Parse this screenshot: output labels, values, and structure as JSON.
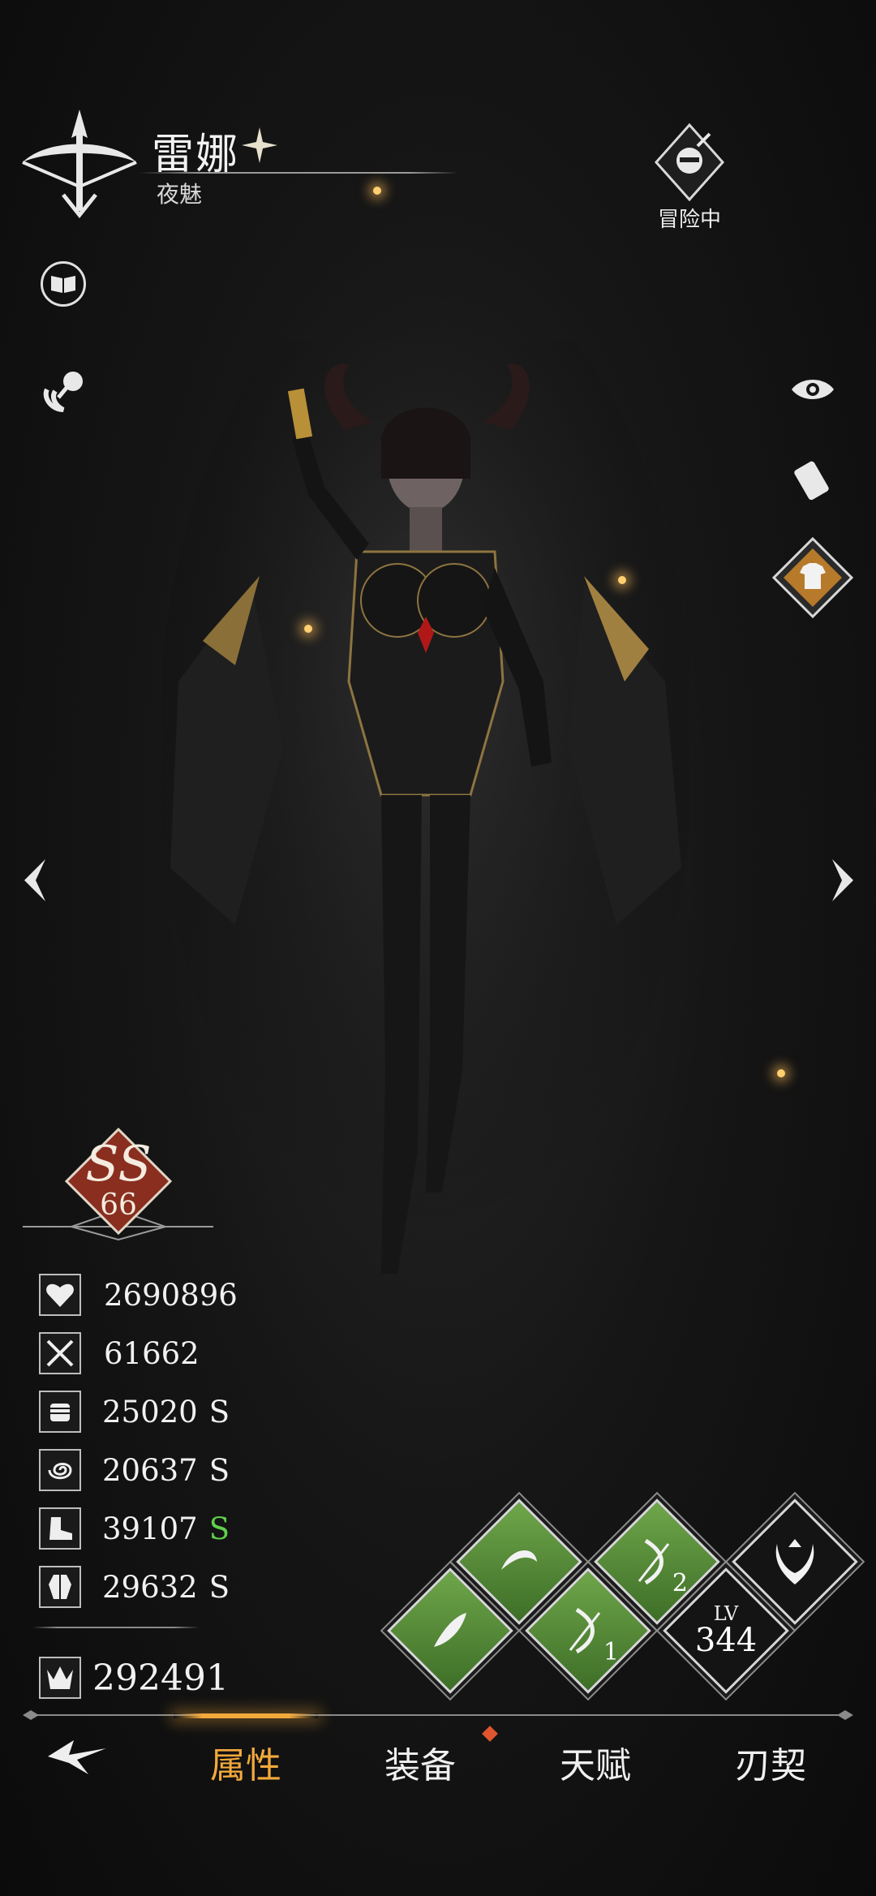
{
  "header": {
    "name": "雷娜",
    "subtitle": "夜魅"
  },
  "status": {
    "label": "冒险中"
  },
  "rank": {
    "grade": "SS",
    "level": "66"
  },
  "stats": [
    {
      "icon": "heart-icon",
      "value": "2690896",
      "grade": ""
    },
    {
      "icon": "crossed-swords-icon",
      "value": "61662",
      "grade": ""
    },
    {
      "icon": "fist-icon",
      "value": "25020",
      "grade": "S"
    },
    {
      "icon": "swirl-icon",
      "value": "20637",
      "grade": "S"
    },
    {
      "icon": "boot-icon",
      "value": "39107",
      "grade": "S",
      "grade_color": "#5fd04a"
    },
    {
      "icon": "torso-icon",
      "value": "29632",
      "grade": "S"
    }
  ],
  "power": {
    "value": "292491"
  },
  "level": {
    "prefix": "LV",
    "value": "344"
  },
  "skills": {
    "slot1": "1",
    "slot2": "2"
  },
  "tabs": [
    {
      "label": "属性",
      "active": true
    },
    {
      "label": "装备",
      "active": false
    },
    {
      "label": "天赋",
      "active": false
    },
    {
      "label": "刃契",
      "active": false
    }
  ],
  "colors": {
    "accent": "#f2a93b",
    "rank_badge": "#8a2e1f",
    "skill_green": "#5a9a3a",
    "notify_dot": "#e0552e"
  }
}
